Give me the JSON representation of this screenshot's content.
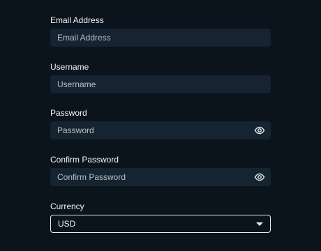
{
  "form": {
    "email": {
      "label": "Email Address",
      "placeholder": "Email Address"
    },
    "username": {
      "label": "Username",
      "placeholder": "Username"
    },
    "password": {
      "label": "Password",
      "placeholder": "Password",
      "toggle_icon": "eye-icon"
    },
    "confirm_password": {
      "label": "Confirm Password",
      "placeholder": "Confirm Password",
      "toggle_icon": "eye-icon"
    },
    "currency": {
      "label": "Currency",
      "value": "USD",
      "icon": "chevron-down-icon"
    }
  },
  "colors": {
    "background": "#0b131c",
    "input_background": "#162330",
    "text": "#f2f5f8",
    "placeholder": "#b7c0ca",
    "select_border": "#e8edf2"
  }
}
